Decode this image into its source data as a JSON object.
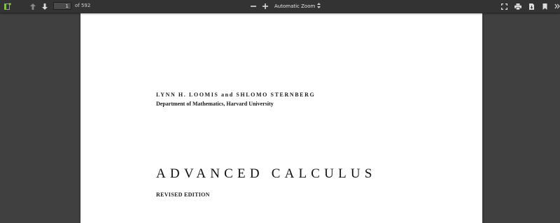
{
  "toolbar": {
    "page_number": "1",
    "page_count": "of 592",
    "zoom_label": "Automatic Zoom",
    "icons": [
      "sidebar-toggle-icon",
      "arrow-up-icon",
      "arrow-down-icon",
      "minus-icon",
      "plus-icon",
      "chevron-updown-icon",
      "fullscreen-icon",
      "print-icon",
      "download-icon",
      "bookmark-icon",
      "chevron-double-right-icon"
    ]
  },
  "document": {
    "authors": "LYNN H. LOOMIS and SHLOMO STERNBERG",
    "affiliation": "Department of Mathematics, Harvard University",
    "title": "ADVANCED CALCULUS",
    "edition": "REVISED EDITION"
  },
  "colors": {
    "toolbar_bg": "#333333",
    "viewer_bg": "#404040",
    "page_bg": "#ffffff",
    "sidebar_icon_accent": "#7ec142"
  }
}
